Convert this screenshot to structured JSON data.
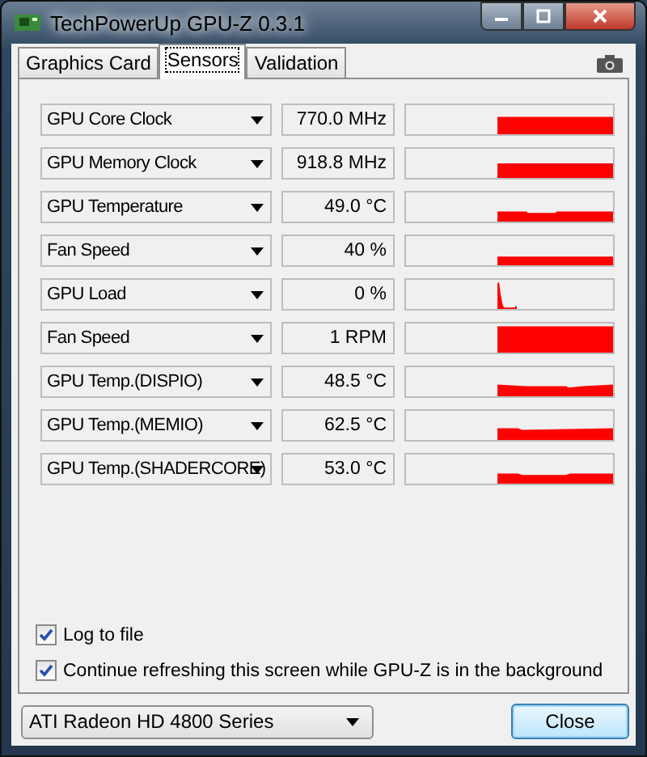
{
  "window": {
    "title": "TechPowerUp GPU-Z 0.3.1"
  },
  "tabs": [
    {
      "label": "Graphics Card",
      "selected": false
    },
    {
      "label": "Sensors",
      "selected": true
    },
    {
      "label": "Validation",
      "selected": false
    }
  ],
  "sensors": [
    {
      "name": "GPU Core Clock",
      "reading": "770.0 MHz"
    },
    {
      "name": "GPU Memory Clock",
      "reading": "918.8 MHz"
    },
    {
      "name": "GPU Temperature",
      "reading": "49.0 °C"
    },
    {
      "name": "Fan Speed",
      "reading": "40 %"
    },
    {
      "name": "GPU Load",
      "reading": "0 %"
    },
    {
      "name": "Fan Speed",
      "reading": "1 RPM"
    },
    {
      "name": "GPU Temp.(DISPIO)",
      "reading": "48.5 °C"
    },
    {
      "name": "GPU Temp.(MEMIO)",
      "reading": "62.5 °C"
    },
    {
      "name": "GPU Temp.(SHADERCORE)",
      "reading": "53.0 °C"
    }
  ],
  "options": [
    {
      "label": "Log to file",
      "checked": true
    },
    {
      "label": "Continue refreshing this screen while GPU-Z is in the background",
      "checked": true
    }
  ],
  "gpu_select": {
    "value": "ATI Radeon HD 4800 Series"
  },
  "buttons": [
    {
      "label": "Close"
    }
  ]
}
